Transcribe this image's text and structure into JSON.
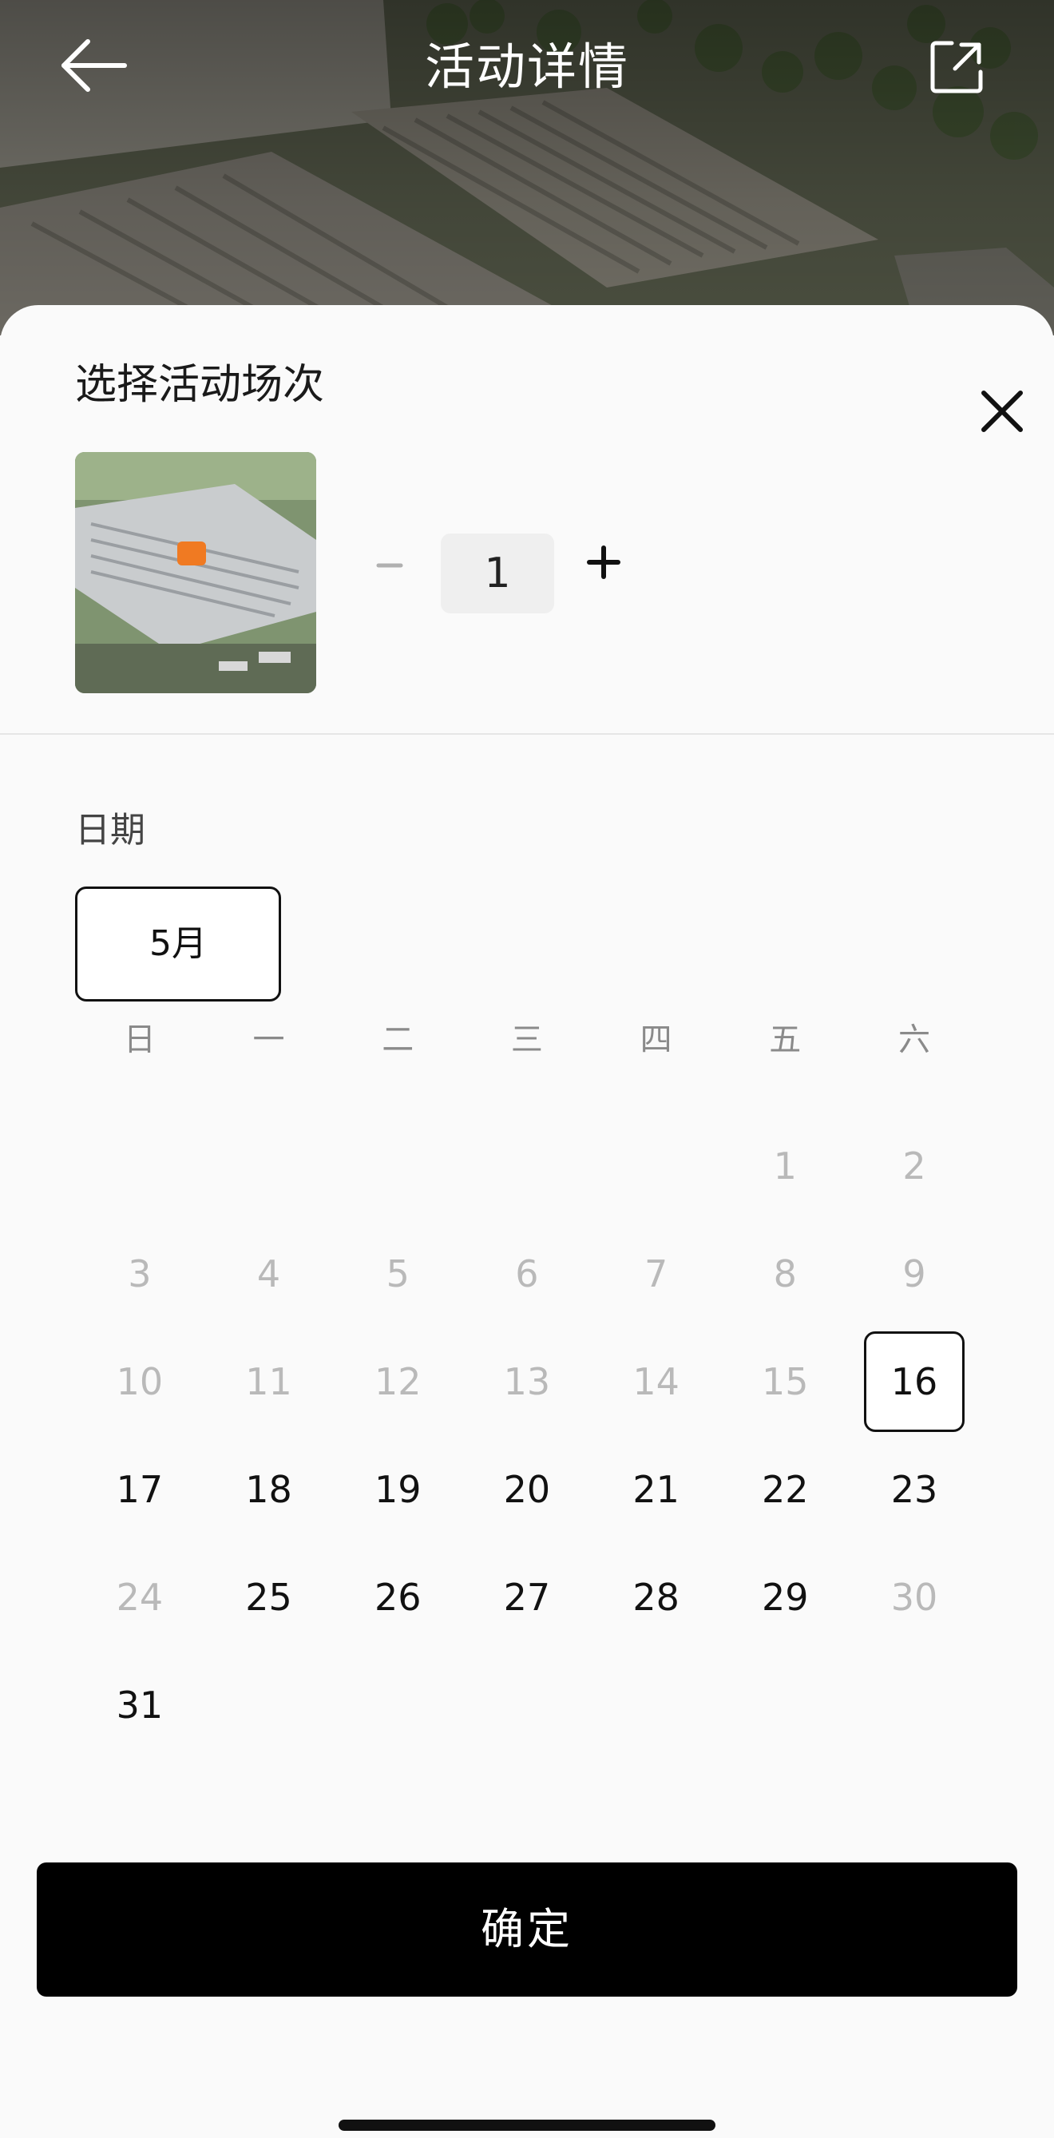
{
  "header": {
    "title": "活动详情",
    "back_icon": "arrow-left-icon",
    "share_icon": "share-external-icon"
  },
  "sheet": {
    "title": "选择活动场次",
    "close_icon": "close-icon",
    "quantity": {
      "minus_label": "−",
      "value": "1",
      "plus_label": "+"
    },
    "date_label": "日期",
    "month_options": [
      "5月"
    ],
    "selected_month": "5月",
    "weekdays": [
      "日",
      "一",
      "二",
      "三",
      "四",
      "五",
      "六"
    ],
    "calendar_weeks": [
      [
        null,
        null,
        null,
        null,
        null,
        {
          "day": "1",
          "state": "disabled"
        },
        {
          "day": "2",
          "state": "disabled"
        }
      ],
      [
        {
          "day": "3",
          "state": "disabled"
        },
        {
          "day": "4",
          "state": "disabled"
        },
        {
          "day": "5",
          "state": "disabled"
        },
        {
          "day": "6",
          "state": "disabled"
        },
        {
          "day": "7",
          "state": "disabled"
        },
        {
          "day": "8",
          "state": "disabled"
        },
        {
          "day": "9",
          "state": "disabled"
        }
      ],
      [
        {
          "day": "10",
          "state": "disabled"
        },
        {
          "day": "11",
          "state": "disabled"
        },
        {
          "day": "12",
          "state": "disabled"
        },
        {
          "day": "13",
          "state": "disabled"
        },
        {
          "day": "14",
          "state": "disabled"
        },
        {
          "day": "15",
          "state": "disabled"
        },
        {
          "day": "16",
          "state": "selected"
        }
      ],
      [
        {
          "day": "17",
          "state": "enabled"
        },
        {
          "day": "18",
          "state": "enabled"
        },
        {
          "day": "19",
          "state": "enabled"
        },
        {
          "day": "20",
          "state": "enabled"
        },
        {
          "day": "21",
          "state": "enabled"
        },
        {
          "day": "22",
          "state": "enabled"
        },
        {
          "day": "23",
          "state": "enabled"
        }
      ],
      [
        {
          "day": "24",
          "state": "disabled"
        },
        {
          "day": "25",
          "state": "enabled"
        },
        {
          "day": "26",
          "state": "enabled"
        },
        {
          "day": "27",
          "state": "enabled"
        },
        {
          "day": "28",
          "state": "enabled"
        },
        {
          "day": "29",
          "state": "enabled"
        },
        {
          "day": "30",
          "state": "disabled"
        }
      ],
      [
        {
          "day": "31",
          "state": "enabled"
        },
        null,
        null,
        null,
        null,
        null,
        null
      ]
    ],
    "confirm_label": "确定"
  },
  "colors": {
    "accent": "#000000",
    "disabled_text": "#b9b9b9",
    "sheet_bg": "#fafafa"
  }
}
